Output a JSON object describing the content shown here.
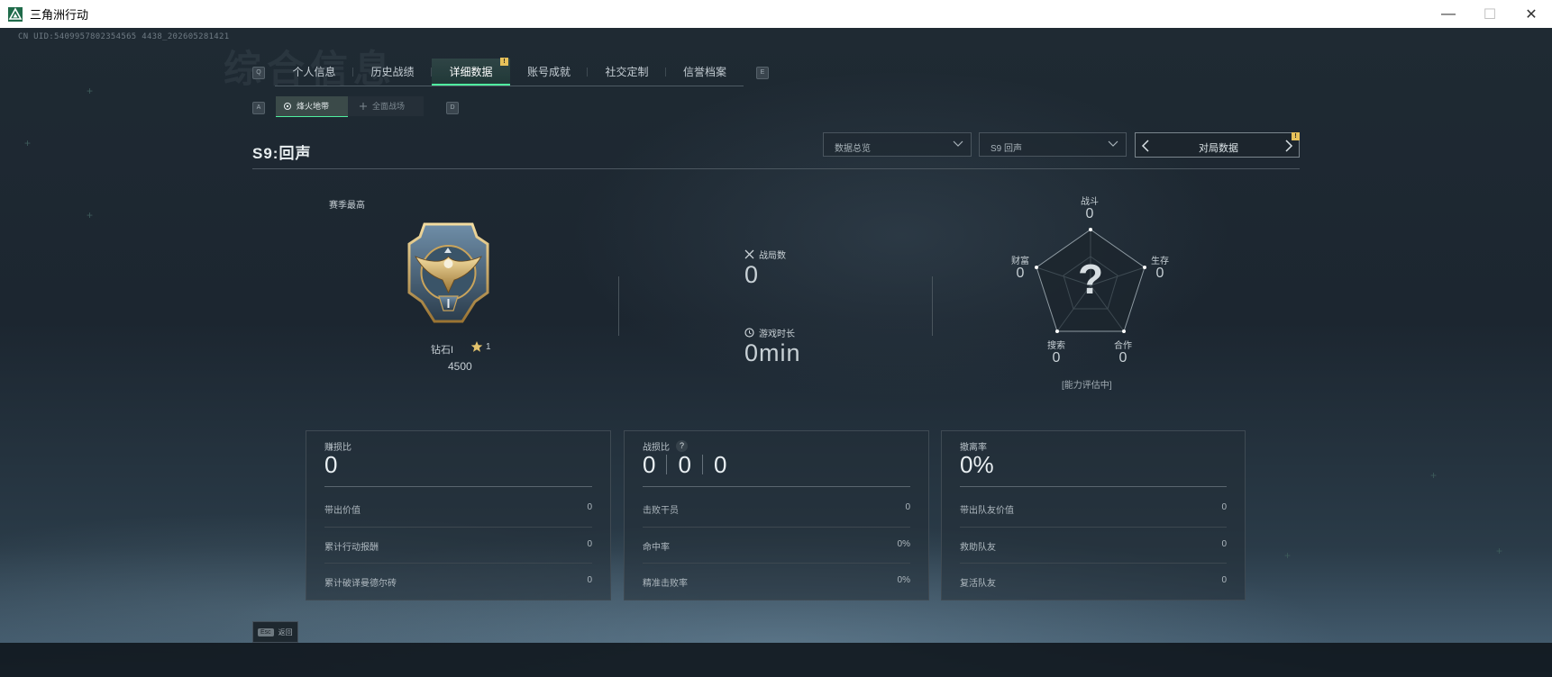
{
  "window": {
    "title": "三角洲行动",
    "minimize": "—",
    "maximize": "☐",
    "close": "✕"
  },
  "uid": "CN UID:5409957802354565 4438_202605281421",
  "watermark": "综合信息",
  "keys": {
    "q": "Q",
    "e": "E",
    "a": "A",
    "d": "D",
    "esc": "Esc"
  },
  "tabs": [
    {
      "label": "个人信息"
    },
    {
      "label": "历史战绩"
    },
    {
      "label": "详细数据",
      "badge": "!"
    },
    {
      "label": "账号成就"
    },
    {
      "label": "社交定制"
    },
    {
      "label": "信誉档案"
    }
  ],
  "subtabs": [
    {
      "label": "烽火地带"
    },
    {
      "label": "全面战场"
    }
  ],
  "season": {
    "title": "S9:回声"
  },
  "filters": {
    "overview": "数据总览",
    "season": "S9 回声",
    "match_data": "对局数据",
    "match_badge": "!"
  },
  "rank": {
    "season_best_label": "赛季最高",
    "name": "钻石I",
    "stars": "1",
    "score": "4500"
  },
  "stats": {
    "matches_label": "战局数",
    "matches_value": "0",
    "playtime_label": "游戏时长",
    "playtime_value": "0min"
  },
  "radar": {
    "axes": [
      {
        "label": "战斗",
        "value": "0"
      },
      {
        "label": "生存",
        "value": "0"
      },
      {
        "label": "合作",
        "value": "0"
      },
      {
        "label": "搜索",
        "value": "0"
      },
      {
        "label": "财富",
        "value": "0"
      }
    ],
    "center": "?",
    "status": "[能力评估中]"
  },
  "panels": {
    "profit": {
      "title": "赚损比",
      "value": "0",
      "rows": [
        {
          "k": "带出价值",
          "v": "0"
        },
        {
          "k": "累计行动报酬",
          "v": "0"
        },
        {
          "k": "累计破译曼德尔砖",
          "v": "0"
        }
      ]
    },
    "kd": {
      "title": "战损比",
      "help": "?",
      "values": [
        "0",
        "0",
        "0"
      ],
      "rows": [
        {
          "k": "击败干员",
          "v": "0"
        },
        {
          "k": "命中率",
          "v": "0%"
        },
        {
          "k": "精准击败率",
          "v": "0%"
        }
      ]
    },
    "extract": {
      "title": "撤离率",
      "value": "0%",
      "rows": [
        {
          "k": "带出队友价值",
          "v": "0"
        },
        {
          "k": "救助队友",
          "v": "0"
        },
        {
          "k": "复活队友",
          "v": "0"
        }
      ]
    }
  },
  "footer": {
    "back": "返回"
  },
  "colors": {
    "accent": "#4ff0a0",
    "badge": "#e6c15a"
  }
}
